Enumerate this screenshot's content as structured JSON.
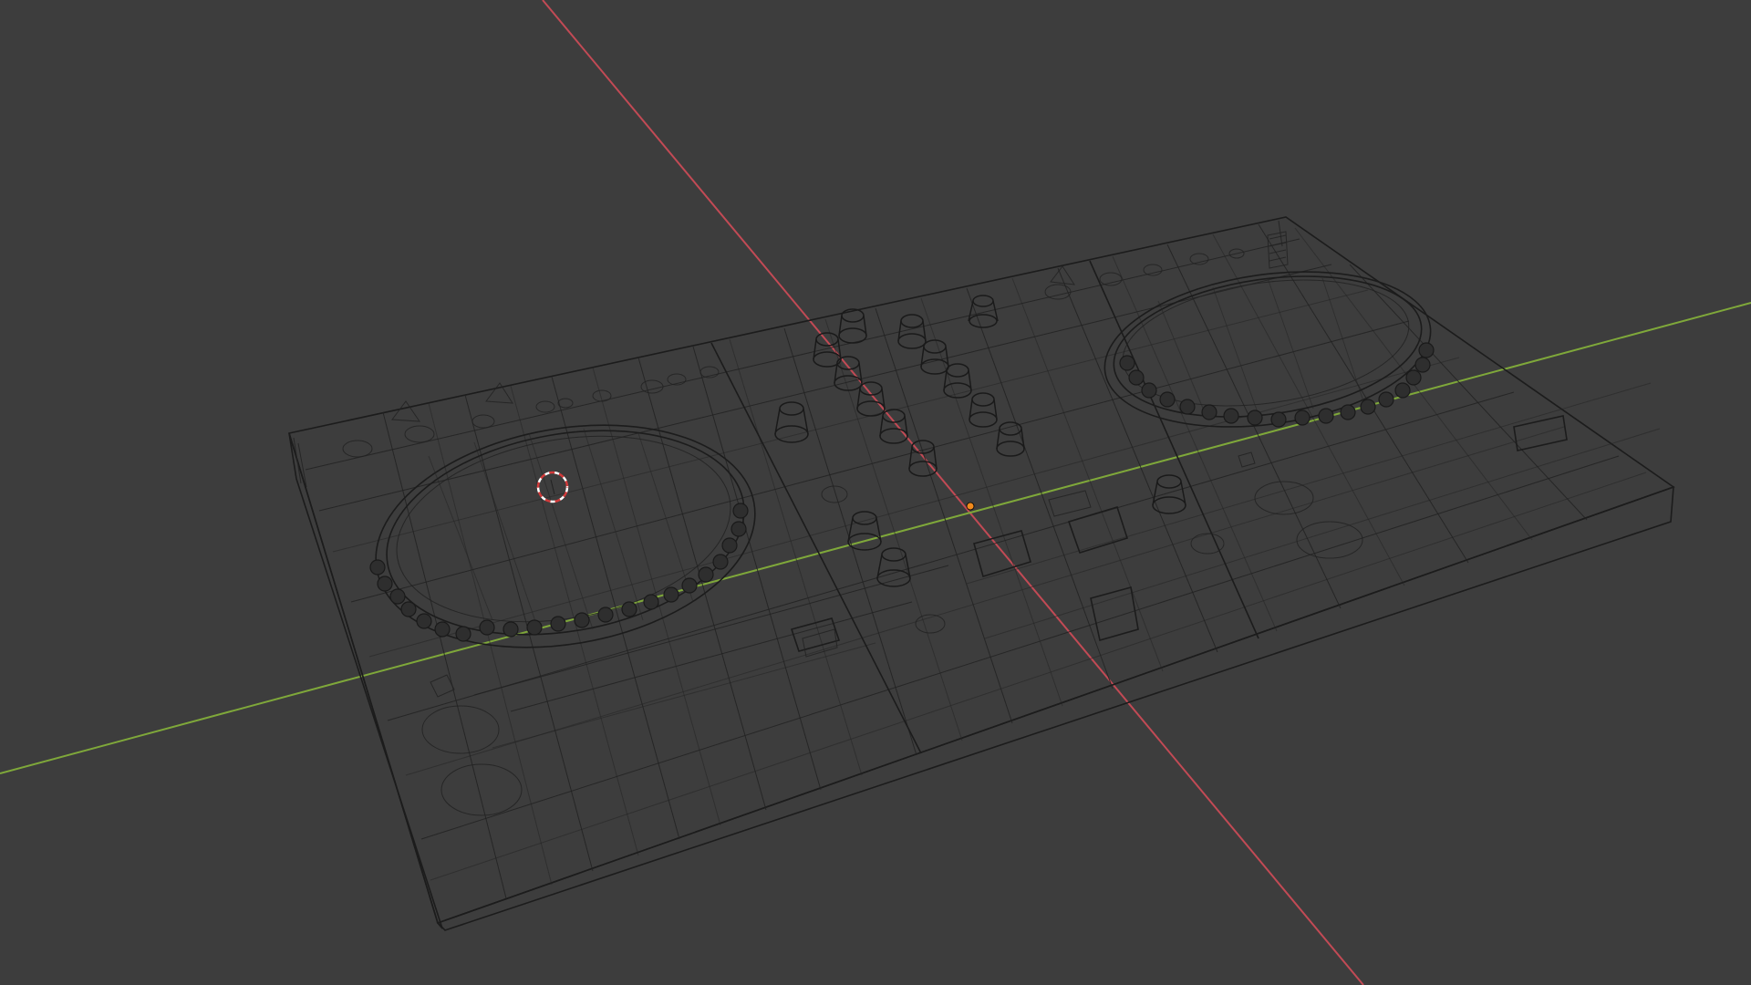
{
  "viewport": {
    "mode": "wireframe",
    "background": "#3d3d3d",
    "wire_color": "#1c1c1c"
  },
  "axes": {
    "x_axis_color": "#c24a55",
    "y_axis_color": "#7fa83a"
  },
  "gizmos": {
    "cursor_3d": "3d-cursor-icon",
    "object_origin": "origin-point-icon",
    "origin_color": "#f08a1c"
  },
  "scene": {
    "object": "dj-controller-mesh"
  }
}
